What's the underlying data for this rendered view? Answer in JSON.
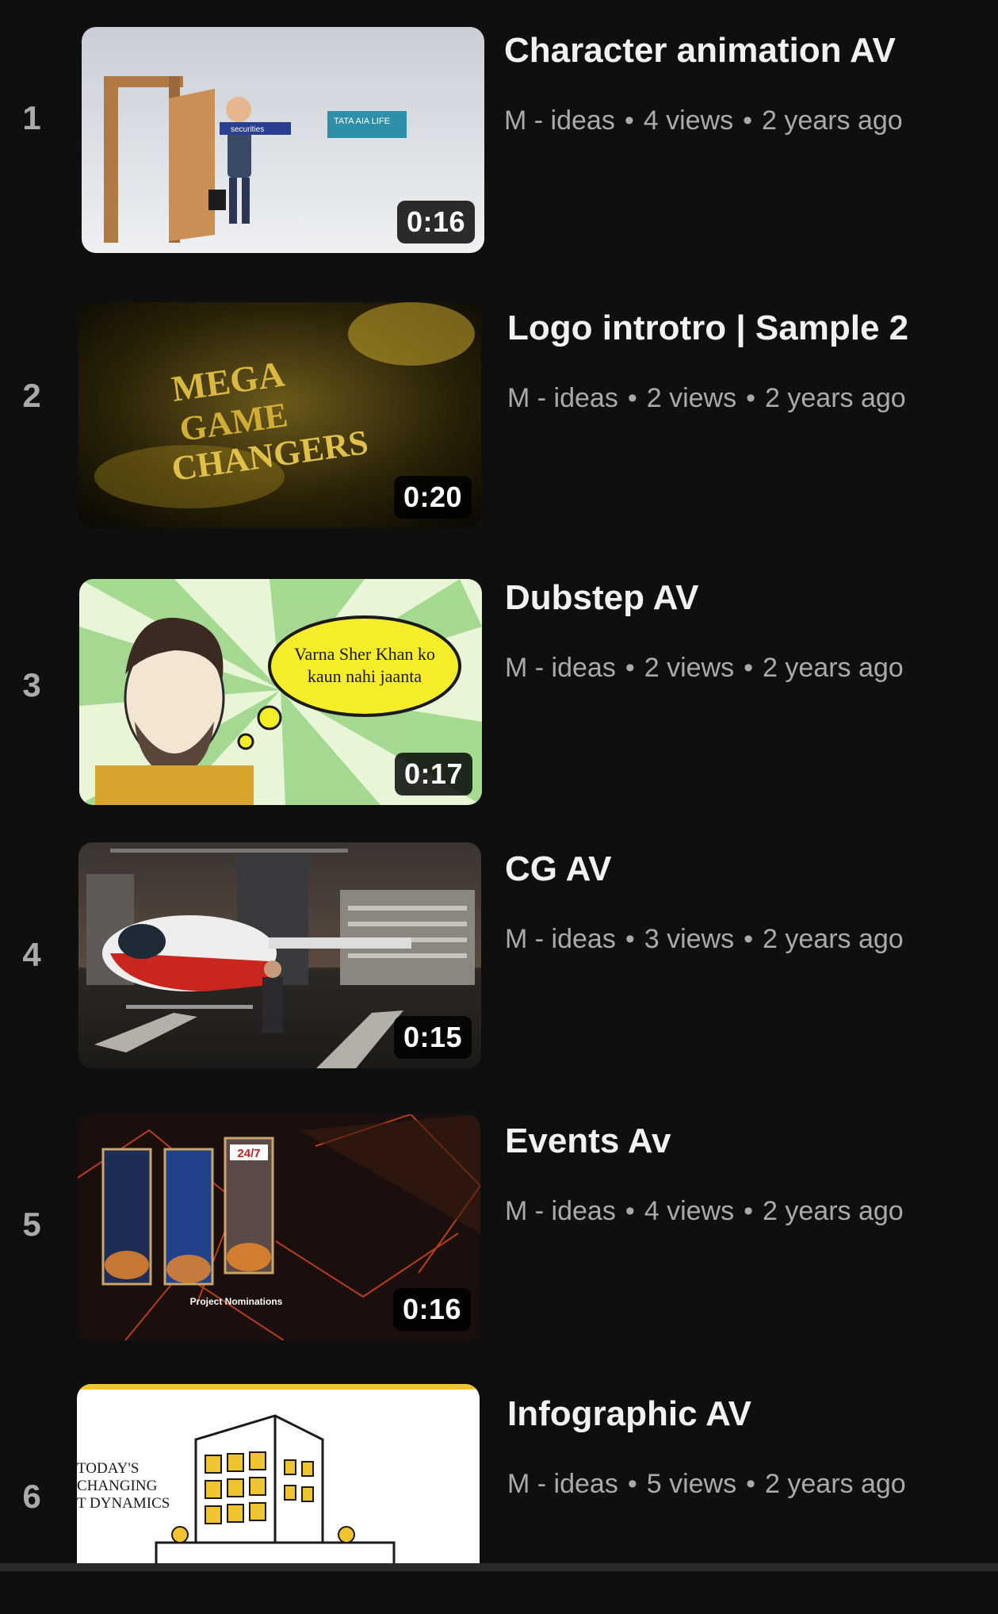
{
  "colors": {
    "background": "#0f0f0f",
    "title": "#f1f1f1",
    "meta": "#aaaaaa",
    "duration_bg": "#000000"
  },
  "playlist": {
    "items": [
      {
        "index": "1",
        "title": "Character animation AV",
        "channel": "M - ideas",
        "views": "4 views",
        "age": "2 years ago",
        "duration": "0:16",
        "thumb_text": [
          "securities",
          "TATA AIA LIFE"
        ]
      },
      {
        "index": "2",
        "title": "Logo introtro | Sample 2",
        "channel": "M - ideas",
        "views": "2 views",
        "age": "2 years ago",
        "duration": "0:20",
        "thumb_text": [
          "MEGA",
          "GAME",
          "CHANGERS"
        ]
      },
      {
        "index": "3",
        "title": "Dubstep AV",
        "channel": "M - ideas",
        "views": "2 views",
        "age": "2 years ago",
        "duration": "0:17",
        "thumb_text": [
          "Varna Sher Khan ko",
          "kaun nahi jaanta"
        ]
      },
      {
        "index": "4",
        "title": "CG AV",
        "channel": "M - ideas",
        "views": "3 views",
        "age": "2 years ago",
        "duration": "0:15",
        "thumb_text": []
      },
      {
        "index": "5",
        "title": "Events Av",
        "channel": "M - ideas",
        "views": "4 views",
        "age": "2 years ago",
        "duration": "0:16",
        "thumb_text": [
          "24/7",
          "Project Nominations"
        ]
      },
      {
        "index": "6",
        "title": "Infographic AV",
        "channel": "M - ideas",
        "views": "5 views",
        "age": "2 years ago",
        "duration": "",
        "thumb_text": [
          "TODAY'S",
          "CHANGING",
          "T DYNAMICS"
        ]
      }
    ]
  }
}
